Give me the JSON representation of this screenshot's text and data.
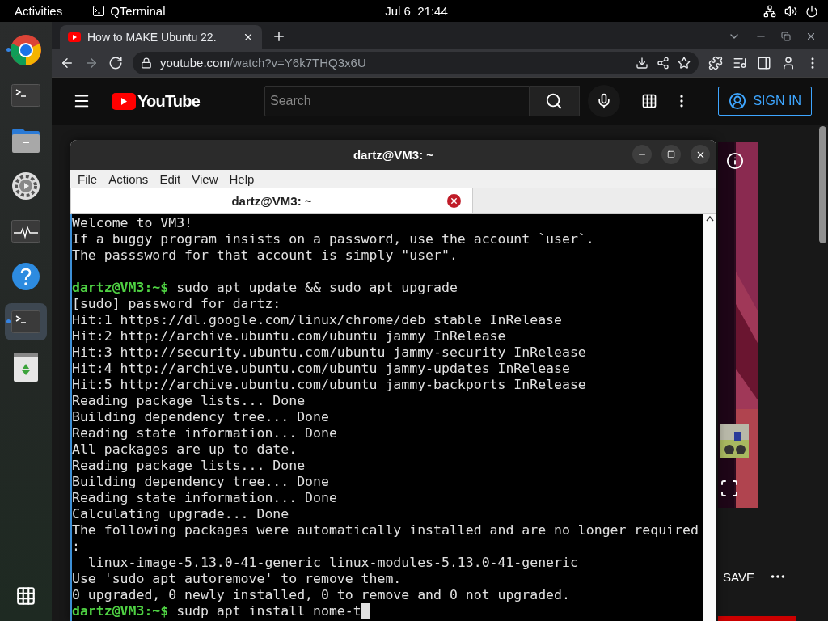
{
  "top_bar": {
    "activities": "Activities",
    "app": "QTerminal",
    "clock": "Jul 6  21:44"
  },
  "dock": {
    "items": [
      {
        "kind": "chrome",
        "running": true,
        "selected": false
      },
      {
        "kind": "terminal",
        "running": false,
        "selected": false
      },
      {
        "kind": "files",
        "running": false,
        "selected": false
      },
      {
        "kind": "settings",
        "running": false,
        "selected": false
      },
      {
        "kind": "monitor",
        "running": false,
        "selected": false
      },
      {
        "kind": "help",
        "running": false,
        "selected": false
      },
      {
        "kind": "terminal",
        "running": true,
        "selected": true
      },
      {
        "kind": "trash",
        "running": false,
        "selected": false
      }
    ]
  },
  "browser": {
    "tabs": [
      {
        "title": "How to MAKE Ubuntu 22.",
        "selected": true
      }
    ],
    "url_host": "youtube.com",
    "url_path": "/watch?v=Y6k7THQ3x6U"
  },
  "youtube": {
    "logo": "YouTube",
    "search_placeholder": "Search",
    "sign_in": "SIGN IN",
    "save": "SAVE"
  },
  "terminal": {
    "title": "dartz@VM3: ~",
    "menu": [
      "File",
      "Actions",
      "Edit",
      "View",
      "Help"
    ],
    "tabs": [
      {
        "title": "dartz@VM3: ~",
        "selected": true
      }
    ],
    "lines": [
      {
        "kind": "output",
        "text": "Welcome to VM3!"
      },
      {
        "kind": "output",
        "text": "If a buggy program insists on a password, use the account `user`."
      },
      {
        "kind": "output",
        "text": "The passsword for that account is simply \"user\"."
      },
      {
        "kind": "blank"
      },
      {
        "kind": "prompt",
        "prompt": "dartz@VM3:~$",
        "command": "sudo apt update && sudo apt upgrade"
      },
      {
        "kind": "output",
        "text": "[sudo] password for dartz:"
      },
      {
        "kind": "output",
        "text": "Hit:1 https://dl.google.com/linux/chrome/deb stable InRelease"
      },
      {
        "kind": "output",
        "text": "Hit:2 http://archive.ubuntu.com/ubuntu jammy InRelease"
      },
      {
        "kind": "output",
        "text": "Hit:3 http://security.ubuntu.com/ubuntu jammy-security InRelease"
      },
      {
        "kind": "output",
        "text": "Hit:4 http://archive.ubuntu.com/ubuntu jammy-updates InRelease"
      },
      {
        "kind": "output",
        "text": "Hit:5 http://archive.ubuntu.com/ubuntu jammy-backports InRelease"
      },
      {
        "kind": "output",
        "text": "Reading package lists... Done"
      },
      {
        "kind": "output",
        "text": "Building dependency tree... Done"
      },
      {
        "kind": "output",
        "text": "Reading state information... Done"
      },
      {
        "kind": "output",
        "text": "All packages are up to date."
      },
      {
        "kind": "output",
        "text": "Reading package lists... Done"
      },
      {
        "kind": "output",
        "text": "Building dependency tree... Done"
      },
      {
        "kind": "output",
        "text": "Reading state information... Done"
      },
      {
        "kind": "output",
        "text": "Calculating upgrade... Done"
      },
      {
        "kind": "output",
        "text": "The following packages were automatically installed and are no longer required"
      },
      {
        "kind": "output",
        "text": ":"
      },
      {
        "kind": "output",
        "text": "  linux-image-5.13.0-41-generic linux-modules-5.13.0-41-generic"
      },
      {
        "kind": "output",
        "text": "Use 'sudo apt autoremove' to remove them."
      },
      {
        "kind": "output",
        "text": "0 upgraded, 0 newly installed, 0 to remove and 0 not upgraded."
      },
      {
        "kind": "prompt",
        "prompt": "dartz@VM3:~$",
        "command": "sudp apt install nome-t",
        "cursor": true
      }
    ]
  }
}
